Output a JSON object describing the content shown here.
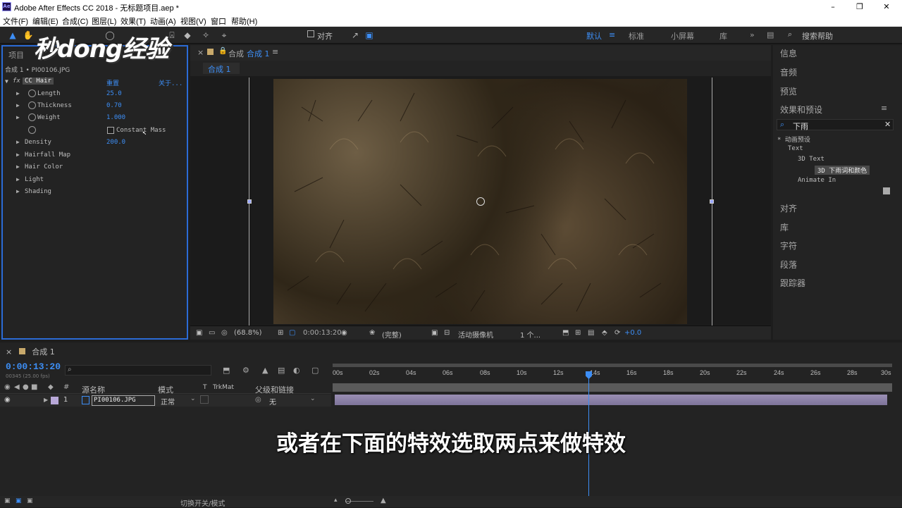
{
  "window": {
    "title": "Adobe After Effects CC 2018 - 无标题项目.aep *",
    "app_icon": "Ae"
  },
  "menu": [
    "文件(F)",
    "编辑(E)",
    "合成(C)",
    "图层(L)",
    "效果(T)",
    "动画(A)",
    "视图(V)",
    "窗口",
    "帮助(H)"
  ],
  "watermark": "秒dong经验",
  "toolbar": {
    "align_label": "对齐",
    "workspaces": {
      "default": "默认",
      "standard": "标准",
      "small_screen": "小屏幕",
      "library": "库"
    },
    "search_help": "搜索帮助",
    "accent_color": "#3d8ef5"
  },
  "effect_controls": {
    "panel_title": "项目",
    "layer_path": "合成 1 • PI00106.JPG",
    "effect_name": "CC Hair",
    "reset": "重置",
    "about": "关于...",
    "params": [
      {
        "name": "Length",
        "value": "25.0"
      },
      {
        "name": "Thickness",
        "value": "0.70"
      },
      {
        "name": "Weight",
        "value": "1.000"
      },
      {
        "name": "Constant Mass",
        "value": ""
      },
      {
        "name": "Density",
        "value": "200.0"
      },
      {
        "name": "Hairfall Map",
        "value": ""
      },
      {
        "name": "Hair Color",
        "value": ""
      },
      {
        "name": "Light",
        "value": ""
      },
      {
        "name": "Shading",
        "value": ""
      }
    ]
  },
  "composition": {
    "tab_prefix": "合成",
    "tab_name": "合成 1",
    "subtab": "合成 1",
    "footer": {
      "zoom": "(68.8%)",
      "time": "0:00:13:20",
      "resolution": "(完整)",
      "camera": "活动摄像机",
      "views": "1 个...",
      "exposure": "+0.0"
    }
  },
  "right_panel": {
    "info": "信息",
    "audio": "音频",
    "preview": "预览",
    "effects_presets": "效果和预设",
    "search_value": "下雨",
    "tree": {
      "root": "* 动画预设",
      "text": "Text",
      "text3d": "3D Text",
      "selected": "3D 下雨词和颜色",
      "animate_in": "Animate In"
    },
    "align": "对齐",
    "library": "库",
    "character": "字符",
    "paragraph": "段落",
    "tracker": "跟踪器"
  },
  "timeline": {
    "tab": "合成 1",
    "timecode": "0:00:13:20",
    "fps_line": "00345 (25.00 fps)",
    "columns": {
      "source": "源名称",
      "mode": "模式",
      "t": "T",
      "trkmat": "TrkMat",
      "parent": "父级和链接"
    },
    "ruler": [
      "00s",
      "02s",
      "04s",
      "06s",
      "08s",
      "10s",
      "12s",
      "14s",
      "16s",
      "18s",
      "20s",
      "22s",
      "24s",
      "26s",
      "28s",
      "30s"
    ],
    "playhead_time": "14s",
    "layer": {
      "number": "1",
      "name": "PI00106.JPG",
      "mode": "正常",
      "parent": "无"
    },
    "footer": "切换开关/模式"
  },
  "subtitle": "或者在下面的特效选取两点来做特效"
}
